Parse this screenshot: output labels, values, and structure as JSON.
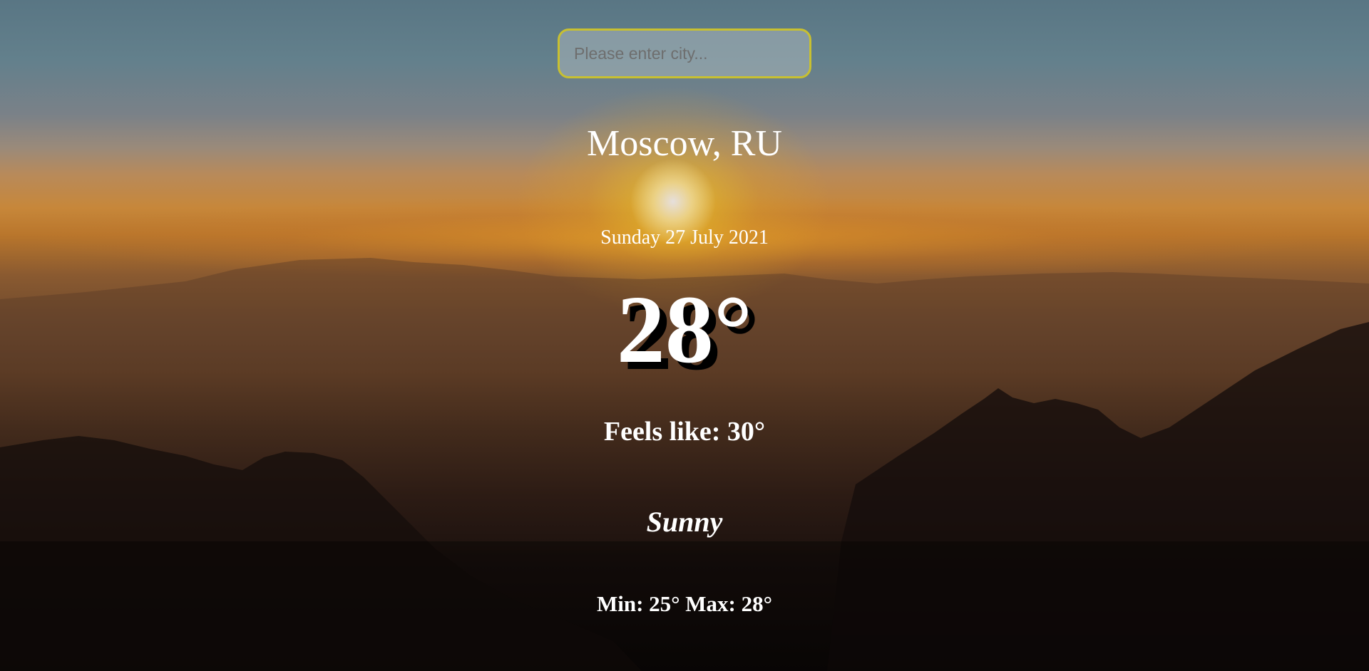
{
  "search": {
    "placeholder": "Please enter city...",
    "value": ""
  },
  "weather": {
    "location": "Moscow, RU",
    "date": "Sunday 27 July 2021",
    "temperature": "28°",
    "feels_like": "Feels like: 30°",
    "condition": "Sunny",
    "min_max": "Min: 25° Max: 28°"
  },
  "colors": {
    "search_border": "#c8c030",
    "text": "#ffffff",
    "temp_shadow": "#000000"
  }
}
